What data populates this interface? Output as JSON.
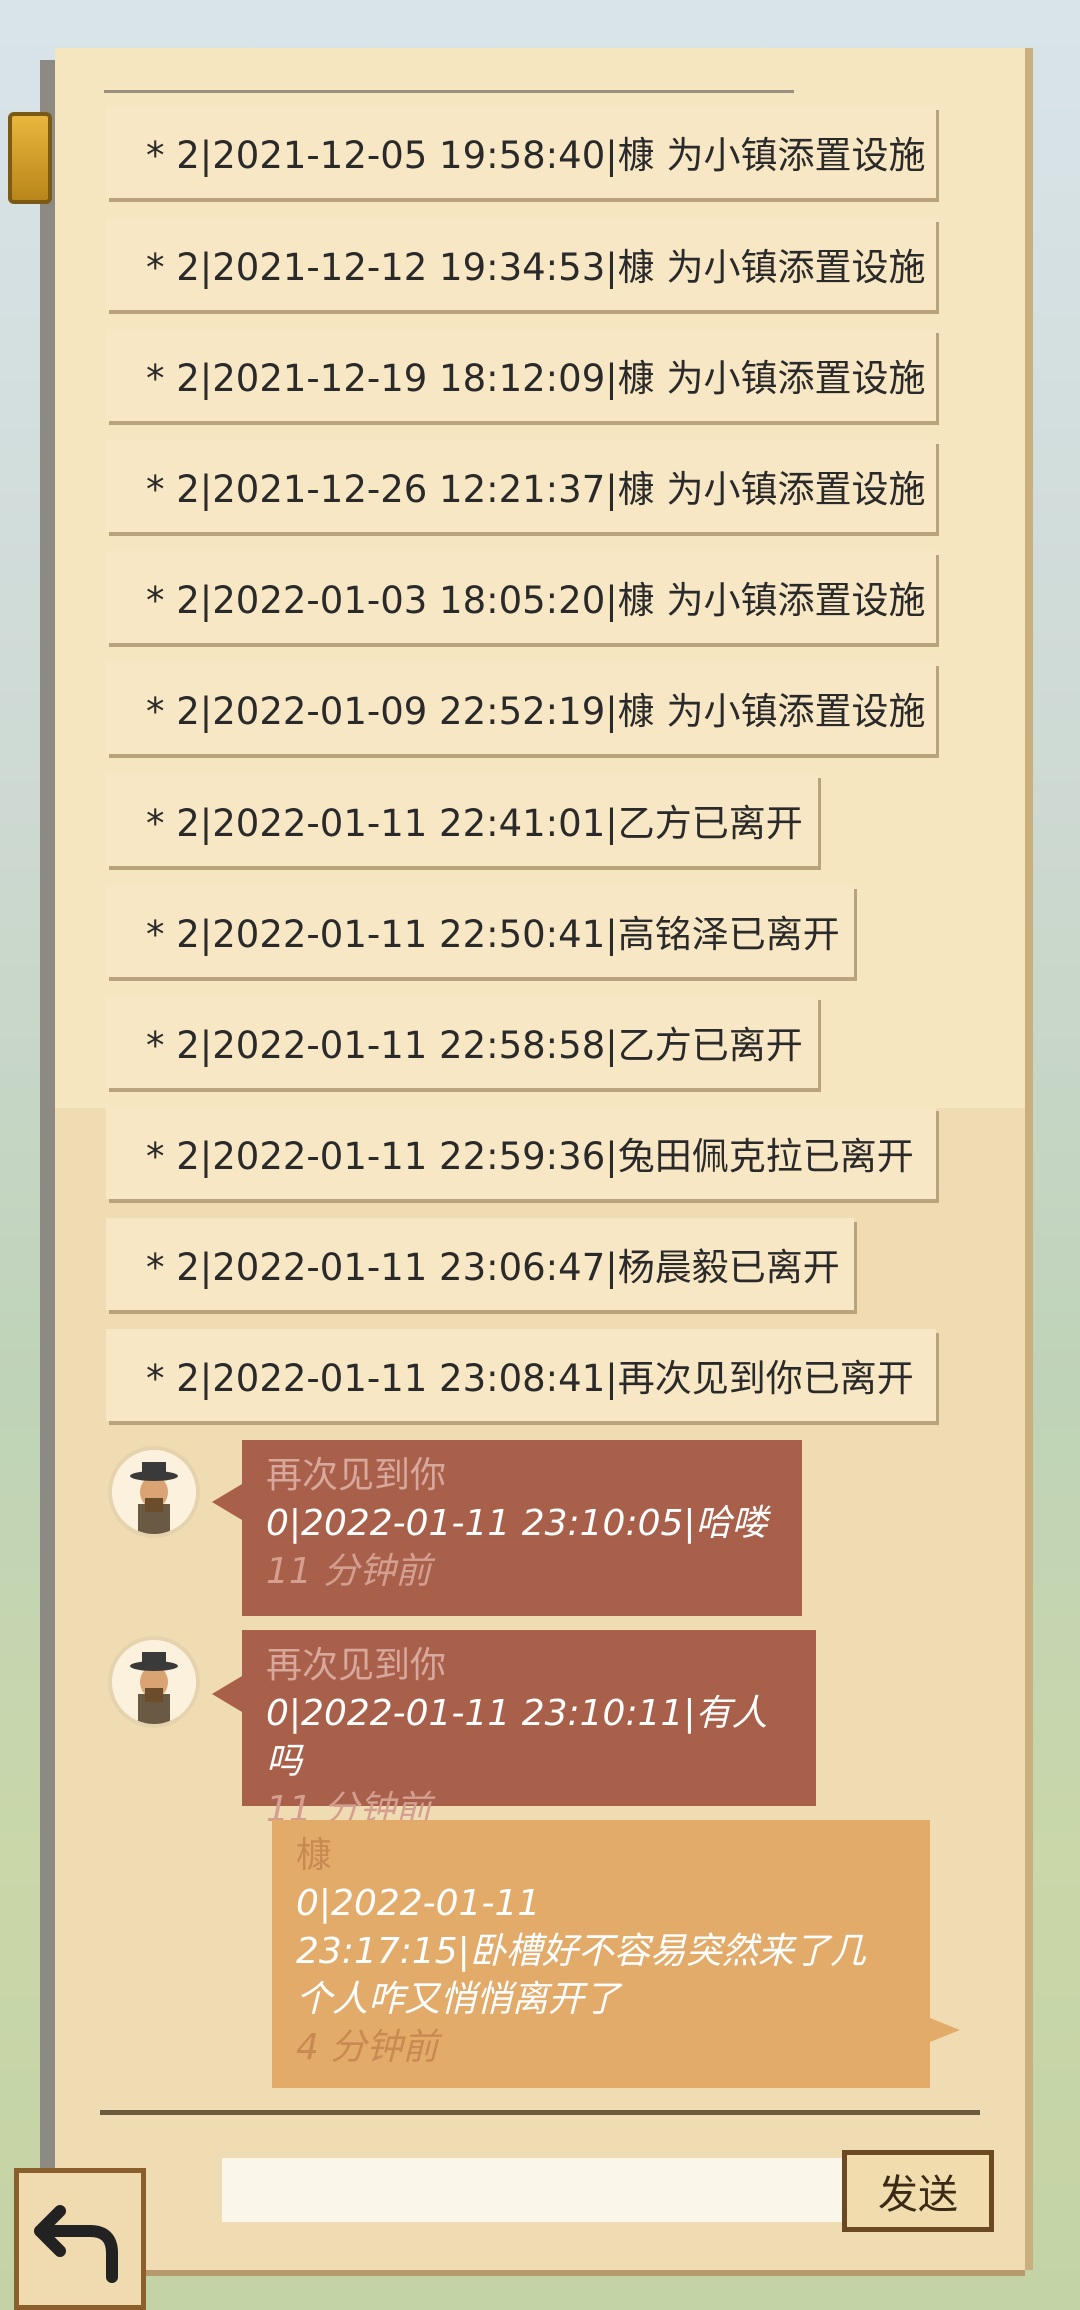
{
  "system_messages": [
    "* 2|2021-12-05 19:58:40|槺 为小镇添置设施",
    "* 2|2021-12-12 19:34:53|槺 为小镇添置设施",
    "* 2|2021-12-19 18:12:09|槺 为小镇添置设施",
    "* 2|2021-12-26 12:21:37|槺 为小镇添置设施",
    "* 2|2022-01-03 18:05:20|槺 为小镇添置设施",
    "* 2|2022-01-09 22:52:19|槺 为小镇添置设施",
    "* 2|2022-01-11 22:41:01|乙方已离开",
    "* 2|2022-01-11 22:50:41|高铭泽已离开",
    "* 2|2022-01-11 22:58:58|乙方已离开",
    "* 2|2022-01-11 22:59:36|兔田佩克拉已离开",
    "* 2|2022-01-11 23:06:47|杨晨毅已离开",
    "* 2|2022-01-11 23:08:41|再次见到你已离开"
  ],
  "chat": [
    {
      "sender": "再次见到你",
      "text": "0|2022-01-11 23:10:05|哈喽",
      "time": "11 分钟前"
    },
    {
      "sender": "再次见到你",
      "text": "0|2022-01-11 23:10:11|有人吗",
      "time": "11 分钟前"
    },
    {
      "sender": "槺",
      "text": "0|2022-01-11\n23:17:15|卧槽好不容易突然来了几\n个人咋又悄悄离开了",
      "time": "4 分钟前"
    }
  ],
  "composer": {
    "input_value": "",
    "send_label": "发送"
  },
  "icons": {
    "back": "back-arrow-icon",
    "avatar": "character-avatar-icon"
  },
  "colors": {
    "panel": "#efdcb3",
    "strip": "#f8e7c4",
    "other_bubble": "#a9604b",
    "mine_bubble": "#e3ab6a"
  }
}
